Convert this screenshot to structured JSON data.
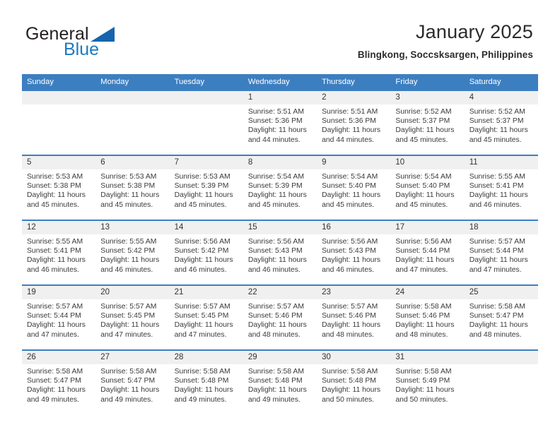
{
  "brand": {
    "name_top": "General",
    "name_bottom": "Blue",
    "logo_icon": "triangle-logo-icon",
    "accent_color": "#1665ad"
  },
  "header": {
    "title": "January 2025",
    "subtitle": "Blingkong, Soccsksargen, Philippines"
  },
  "theme": {
    "header_blue": "#3c7fc1",
    "daynum_band": "#f0f0f0",
    "text": "#3a3a3a"
  },
  "calendar": {
    "weekday_headers": [
      "Sunday",
      "Monday",
      "Tuesday",
      "Wednesday",
      "Thursday",
      "Friday",
      "Saturday"
    ],
    "weeks": [
      [
        {
          "day": "",
          "sunrise": "",
          "sunset": "",
          "daylight_line1": "",
          "daylight_line2": ""
        },
        {
          "day": "",
          "sunrise": "",
          "sunset": "",
          "daylight_line1": "",
          "daylight_line2": ""
        },
        {
          "day": "",
          "sunrise": "",
          "sunset": "",
          "daylight_line1": "",
          "daylight_line2": ""
        },
        {
          "day": "1",
          "sunrise": "Sunrise: 5:51 AM",
          "sunset": "Sunset: 5:36 PM",
          "daylight_line1": "Daylight: 11 hours",
          "daylight_line2": "and 44 minutes."
        },
        {
          "day": "2",
          "sunrise": "Sunrise: 5:51 AM",
          "sunset": "Sunset: 5:36 PM",
          "daylight_line1": "Daylight: 11 hours",
          "daylight_line2": "and 44 minutes."
        },
        {
          "day": "3",
          "sunrise": "Sunrise: 5:52 AM",
          "sunset": "Sunset: 5:37 PM",
          "daylight_line1": "Daylight: 11 hours",
          "daylight_line2": "and 45 minutes."
        },
        {
          "day": "4",
          "sunrise": "Sunrise: 5:52 AM",
          "sunset": "Sunset: 5:37 PM",
          "daylight_line1": "Daylight: 11 hours",
          "daylight_line2": "and 45 minutes."
        }
      ],
      [
        {
          "day": "5",
          "sunrise": "Sunrise: 5:53 AM",
          "sunset": "Sunset: 5:38 PM",
          "daylight_line1": "Daylight: 11 hours",
          "daylight_line2": "and 45 minutes."
        },
        {
          "day": "6",
          "sunrise": "Sunrise: 5:53 AM",
          "sunset": "Sunset: 5:38 PM",
          "daylight_line1": "Daylight: 11 hours",
          "daylight_line2": "and 45 minutes."
        },
        {
          "day": "7",
          "sunrise": "Sunrise: 5:53 AM",
          "sunset": "Sunset: 5:39 PM",
          "daylight_line1": "Daylight: 11 hours",
          "daylight_line2": "and 45 minutes."
        },
        {
          "day": "8",
          "sunrise": "Sunrise: 5:54 AM",
          "sunset": "Sunset: 5:39 PM",
          "daylight_line1": "Daylight: 11 hours",
          "daylight_line2": "and 45 minutes."
        },
        {
          "day": "9",
          "sunrise": "Sunrise: 5:54 AM",
          "sunset": "Sunset: 5:40 PM",
          "daylight_line1": "Daylight: 11 hours",
          "daylight_line2": "and 45 minutes."
        },
        {
          "day": "10",
          "sunrise": "Sunrise: 5:54 AM",
          "sunset": "Sunset: 5:40 PM",
          "daylight_line1": "Daylight: 11 hours",
          "daylight_line2": "and 45 minutes."
        },
        {
          "day": "11",
          "sunrise": "Sunrise: 5:55 AM",
          "sunset": "Sunset: 5:41 PM",
          "daylight_line1": "Daylight: 11 hours",
          "daylight_line2": "and 46 minutes."
        }
      ],
      [
        {
          "day": "12",
          "sunrise": "Sunrise: 5:55 AM",
          "sunset": "Sunset: 5:41 PM",
          "daylight_line1": "Daylight: 11 hours",
          "daylight_line2": "and 46 minutes."
        },
        {
          "day": "13",
          "sunrise": "Sunrise: 5:55 AM",
          "sunset": "Sunset: 5:42 PM",
          "daylight_line1": "Daylight: 11 hours",
          "daylight_line2": "and 46 minutes."
        },
        {
          "day": "14",
          "sunrise": "Sunrise: 5:56 AM",
          "sunset": "Sunset: 5:42 PM",
          "daylight_line1": "Daylight: 11 hours",
          "daylight_line2": "and 46 minutes."
        },
        {
          "day": "15",
          "sunrise": "Sunrise: 5:56 AM",
          "sunset": "Sunset: 5:43 PM",
          "daylight_line1": "Daylight: 11 hours",
          "daylight_line2": "and 46 minutes."
        },
        {
          "day": "16",
          "sunrise": "Sunrise: 5:56 AM",
          "sunset": "Sunset: 5:43 PM",
          "daylight_line1": "Daylight: 11 hours",
          "daylight_line2": "and 46 minutes."
        },
        {
          "day": "17",
          "sunrise": "Sunrise: 5:56 AM",
          "sunset": "Sunset: 5:44 PM",
          "daylight_line1": "Daylight: 11 hours",
          "daylight_line2": "and 47 minutes."
        },
        {
          "day": "18",
          "sunrise": "Sunrise: 5:57 AM",
          "sunset": "Sunset: 5:44 PM",
          "daylight_line1": "Daylight: 11 hours",
          "daylight_line2": "and 47 minutes."
        }
      ],
      [
        {
          "day": "19",
          "sunrise": "Sunrise: 5:57 AM",
          "sunset": "Sunset: 5:44 PM",
          "daylight_line1": "Daylight: 11 hours",
          "daylight_line2": "and 47 minutes."
        },
        {
          "day": "20",
          "sunrise": "Sunrise: 5:57 AM",
          "sunset": "Sunset: 5:45 PM",
          "daylight_line1": "Daylight: 11 hours",
          "daylight_line2": "and 47 minutes."
        },
        {
          "day": "21",
          "sunrise": "Sunrise: 5:57 AM",
          "sunset": "Sunset: 5:45 PM",
          "daylight_line1": "Daylight: 11 hours",
          "daylight_line2": "and 47 minutes."
        },
        {
          "day": "22",
          "sunrise": "Sunrise: 5:57 AM",
          "sunset": "Sunset: 5:46 PM",
          "daylight_line1": "Daylight: 11 hours",
          "daylight_line2": "and 48 minutes."
        },
        {
          "day": "23",
          "sunrise": "Sunrise: 5:57 AM",
          "sunset": "Sunset: 5:46 PM",
          "daylight_line1": "Daylight: 11 hours",
          "daylight_line2": "and 48 minutes."
        },
        {
          "day": "24",
          "sunrise": "Sunrise: 5:58 AM",
          "sunset": "Sunset: 5:46 PM",
          "daylight_line1": "Daylight: 11 hours",
          "daylight_line2": "and 48 minutes."
        },
        {
          "day": "25",
          "sunrise": "Sunrise: 5:58 AM",
          "sunset": "Sunset: 5:47 PM",
          "daylight_line1": "Daylight: 11 hours",
          "daylight_line2": "and 48 minutes."
        }
      ],
      [
        {
          "day": "26",
          "sunrise": "Sunrise: 5:58 AM",
          "sunset": "Sunset: 5:47 PM",
          "daylight_line1": "Daylight: 11 hours",
          "daylight_line2": "and 49 minutes."
        },
        {
          "day": "27",
          "sunrise": "Sunrise: 5:58 AM",
          "sunset": "Sunset: 5:47 PM",
          "daylight_line1": "Daylight: 11 hours",
          "daylight_line2": "and 49 minutes."
        },
        {
          "day": "28",
          "sunrise": "Sunrise: 5:58 AM",
          "sunset": "Sunset: 5:48 PM",
          "daylight_line1": "Daylight: 11 hours",
          "daylight_line2": "and 49 minutes."
        },
        {
          "day": "29",
          "sunrise": "Sunrise: 5:58 AM",
          "sunset": "Sunset: 5:48 PM",
          "daylight_line1": "Daylight: 11 hours",
          "daylight_line2": "and 49 minutes."
        },
        {
          "day": "30",
          "sunrise": "Sunrise: 5:58 AM",
          "sunset": "Sunset: 5:48 PM",
          "daylight_line1": "Daylight: 11 hours",
          "daylight_line2": "and 50 minutes."
        },
        {
          "day": "31",
          "sunrise": "Sunrise: 5:58 AM",
          "sunset": "Sunset: 5:49 PM",
          "daylight_line1": "Daylight: 11 hours",
          "daylight_line2": "and 50 minutes."
        },
        {
          "day": "",
          "sunrise": "",
          "sunset": "",
          "daylight_line1": "",
          "daylight_line2": ""
        }
      ]
    ]
  }
}
